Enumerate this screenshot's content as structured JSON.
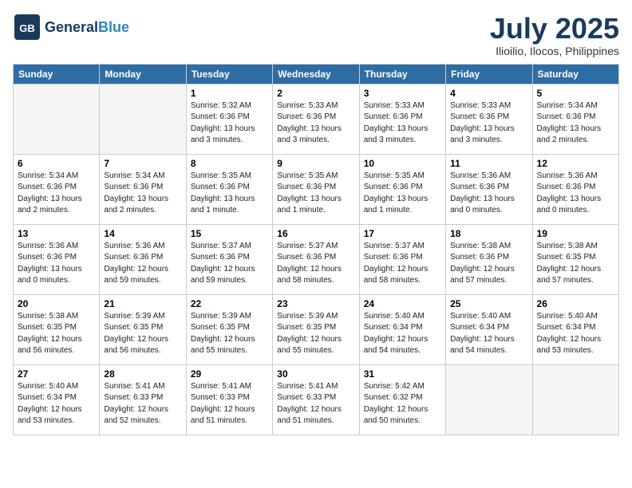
{
  "header": {
    "logo_general": "General",
    "logo_blue": "Blue",
    "month_title": "July 2025",
    "location": "Ilioilio, Ilocos, Philippines"
  },
  "weekdays": [
    "Sunday",
    "Monday",
    "Tuesday",
    "Wednesday",
    "Thursday",
    "Friday",
    "Saturday"
  ],
  "weeks": [
    [
      {
        "day": "",
        "info": ""
      },
      {
        "day": "",
        "info": ""
      },
      {
        "day": "1",
        "info": "Sunrise: 5:32 AM\nSunset: 6:36 PM\nDaylight: 13 hours\nand 3 minutes."
      },
      {
        "day": "2",
        "info": "Sunrise: 5:33 AM\nSunset: 6:36 PM\nDaylight: 13 hours\nand 3 minutes."
      },
      {
        "day": "3",
        "info": "Sunrise: 5:33 AM\nSunset: 6:36 PM\nDaylight: 13 hours\nand 3 minutes."
      },
      {
        "day": "4",
        "info": "Sunrise: 5:33 AM\nSunset: 6:36 PM\nDaylight: 13 hours\nand 3 minutes."
      },
      {
        "day": "5",
        "info": "Sunrise: 5:34 AM\nSunset: 6:36 PM\nDaylight: 13 hours\nand 2 minutes."
      }
    ],
    [
      {
        "day": "6",
        "info": "Sunrise: 5:34 AM\nSunset: 6:36 PM\nDaylight: 13 hours\nand 2 minutes."
      },
      {
        "day": "7",
        "info": "Sunrise: 5:34 AM\nSunset: 6:36 PM\nDaylight: 13 hours\nand 2 minutes."
      },
      {
        "day": "8",
        "info": "Sunrise: 5:35 AM\nSunset: 6:36 PM\nDaylight: 13 hours\nand 1 minute."
      },
      {
        "day": "9",
        "info": "Sunrise: 5:35 AM\nSunset: 6:36 PM\nDaylight: 13 hours\nand 1 minute."
      },
      {
        "day": "10",
        "info": "Sunrise: 5:35 AM\nSunset: 6:36 PM\nDaylight: 13 hours\nand 1 minute."
      },
      {
        "day": "11",
        "info": "Sunrise: 5:36 AM\nSunset: 6:36 PM\nDaylight: 13 hours\nand 0 minutes."
      },
      {
        "day": "12",
        "info": "Sunrise: 5:36 AM\nSunset: 6:36 PM\nDaylight: 13 hours\nand 0 minutes."
      }
    ],
    [
      {
        "day": "13",
        "info": "Sunrise: 5:36 AM\nSunset: 6:36 PM\nDaylight: 13 hours\nand 0 minutes."
      },
      {
        "day": "14",
        "info": "Sunrise: 5:36 AM\nSunset: 6:36 PM\nDaylight: 12 hours\nand 59 minutes."
      },
      {
        "day": "15",
        "info": "Sunrise: 5:37 AM\nSunset: 6:36 PM\nDaylight: 12 hours\nand 59 minutes."
      },
      {
        "day": "16",
        "info": "Sunrise: 5:37 AM\nSunset: 6:36 PM\nDaylight: 12 hours\nand 58 minutes."
      },
      {
        "day": "17",
        "info": "Sunrise: 5:37 AM\nSunset: 6:36 PM\nDaylight: 12 hours\nand 58 minutes."
      },
      {
        "day": "18",
        "info": "Sunrise: 5:38 AM\nSunset: 6:36 PM\nDaylight: 12 hours\nand 57 minutes."
      },
      {
        "day": "19",
        "info": "Sunrise: 5:38 AM\nSunset: 6:35 PM\nDaylight: 12 hours\nand 57 minutes."
      }
    ],
    [
      {
        "day": "20",
        "info": "Sunrise: 5:38 AM\nSunset: 6:35 PM\nDaylight: 12 hours\nand 56 minutes."
      },
      {
        "day": "21",
        "info": "Sunrise: 5:39 AM\nSunset: 6:35 PM\nDaylight: 12 hours\nand 56 minutes."
      },
      {
        "day": "22",
        "info": "Sunrise: 5:39 AM\nSunset: 6:35 PM\nDaylight: 12 hours\nand 55 minutes."
      },
      {
        "day": "23",
        "info": "Sunrise: 5:39 AM\nSunset: 6:35 PM\nDaylight: 12 hours\nand 55 minutes."
      },
      {
        "day": "24",
        "info": "Sunrise: 5:40 AM\nSunset: 6:34 PM\nDaylight: 12 hours\nand 54 minutes."
      },
      {
        "day": "25",
        "info": "Sunrise: 5:40 AM\nSunset: 6:34 PM\nDaylight: 12 hours\nand 54 minutes."
      },
      {
        "day": "26",
        "info": "Sunrise: 5:40 AM\nSunset: 6:34 PM\nDaylight: 12 hours\nand 53 minutes."
      }
    ],
    [
      {
        "day": "27",
        "info": "Sunrise: 5:40 AM\nSunset: 6:34 PM\nDaylight: 12 hours\nand 53 minutes."
      },
      {
        "day": "28",
        "info": "Sunrise: 5:41 AM\nSunset: 6:33 PM\nDaylight: 12 hours\nand 52 minutes."
      },
      {
        "day": "29",
        "info": "Sunrise: 5:41 AM\nSunset: 6:33 PM\nDaylight: 12 hours\nand 51 minutes."
      },
      {
        "day": "30",
        "info": "Sunrise: 5:41 AM\nSunset: 6:33 PM\nDaylight: 12 hours\nand 51 minutes."
      },
      {
        "day": "31",
        "info": "Sunrise: 5:42 AM\nSunset: 6:32 PM\nDaylight: 12 hours\nand 50 minutes."
      },
      {
        "day": "",
        "info": ""
      },
      {
        "day": "",
        "info": ""
      }
    ]
  ]
}
